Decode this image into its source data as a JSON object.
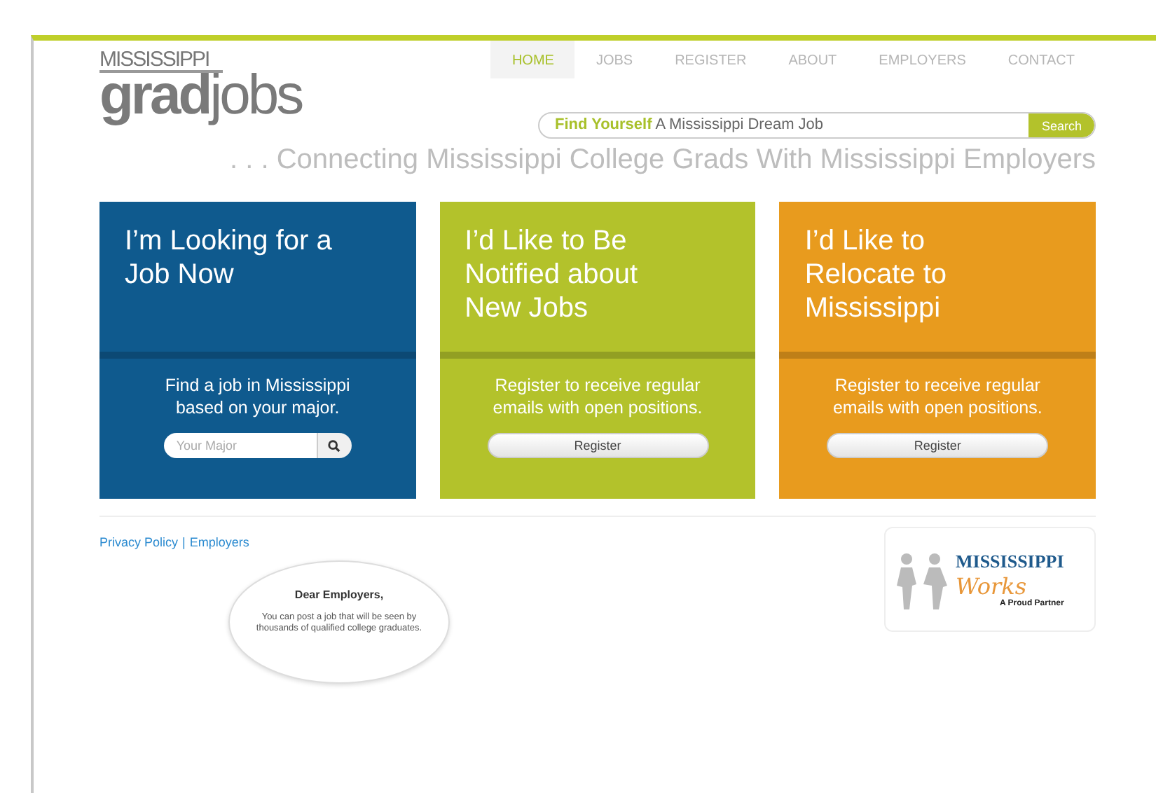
{
  "nav": [
    {
      "label": "HOME",
      "selected": true
    },
    {
      "label": "JOBS",
      "selected": false
    },
    {
      "label": "REGISTER",
      "selected": false
    },
    {
      "label": "ABOUT",
      "selected": false
    },
    {
      "label": "EMPLOYERS",
      "selected": false
    },
    {
      "label": "CONTACT",
      "selected": false
    }
  ],
  "logo": {
    "top": "MISSISSIPPI",
    "grad": "grad",
    "jobs": "jobs"
  },
  "search": {
    "text": "**Find Yourself** A Mississippi Dream Job",
    "button": "Search"
  },
  "tagline": ". . . Connecting Mississippi College Grads With Mississippi Employers",
  "cards": [
    {
      "title": "I’m Looking for a Job Now",
      "color": "#0f5a8e",
      "text": "Find a job in Mississippi based on your major.",
      "kind": "search",
      "placeholder": "Your Major"
    },
    {
      "title": "I’d Like to Be Notified about New Jobs",
      "color": "#b3c22b",
      "text": "Register to receive regular emails with open positions.",
      "kind": "button",
      "button": "Register"
    },
    {
      "title": "I’d Like to Relocate to Mississippi",
      "color": "#e89b1e",
      "text": "Register to receive regular emails with open positions.",
      "kind": "button",
      "button": "Register"
    }
  ],
  "footer_links": [
    "Privacy Policy",
    "Employers"
  ],
  "footer_separator": "|",
  "bubble": {
    "heading": "Dear Employers,",
    "text": "You can post a job that will be seen by thousands of qualified college graduates."
  },
  "partner": {
    "name": "MISSISSIPPI",
    "script": "Works",
    "tagline": "A Proud Partner"
  }
}
